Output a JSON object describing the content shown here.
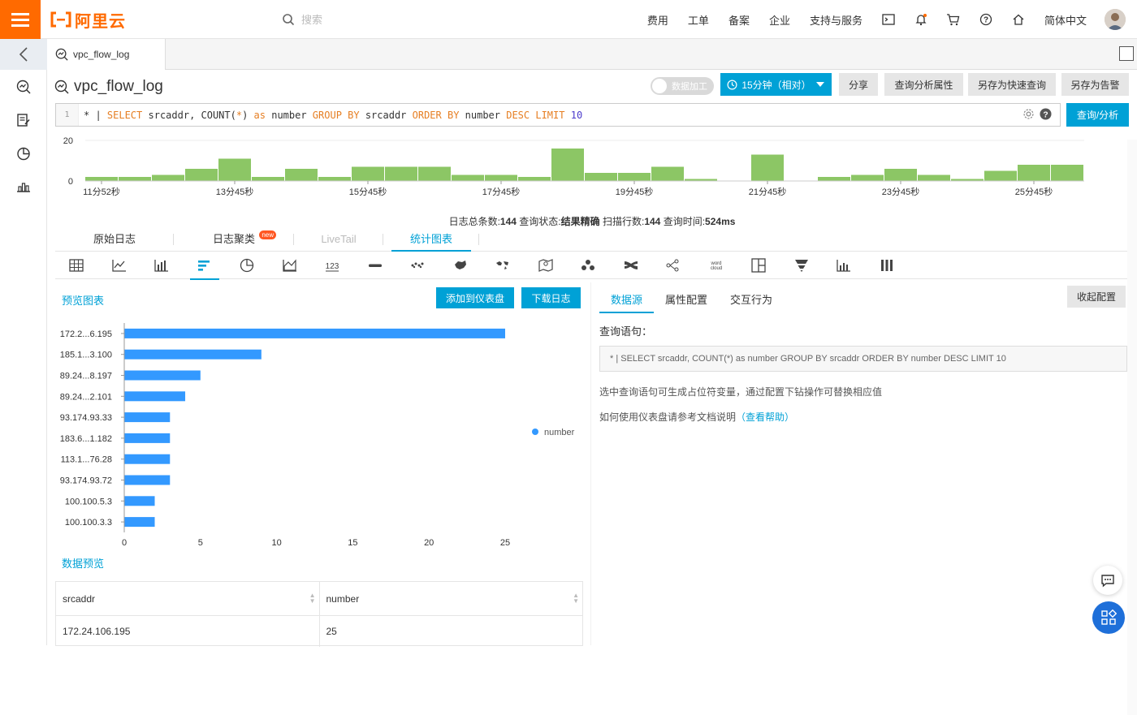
{
  "topbar": {
    "logo_text": "阿里云",
    "search_placeholder": "搜索",
    "nav": [
      "费用",
      "工单",
      "备案",
      "企业",
      "支持与服务"
    ],
    "language": "简体中文"
  },
  "tab": {
    "label": "vpc_flow_log"
  },
  "header": {
    "title": "vpc_flow_log",
    "toggle_label": "数据加工",
    "time_range": "15分钟（相对）",
    "buttons": [
      "分享",
      "查询分析属性",
      "另存为快速查询",
      "另存为告警"
    ]
  },
  "query": {
    "line": "1",
    "parts": [
      {
        "t": "* | ",
        "c": "p"
      },
      {
        "t": "SELECT",
        "c": "k"
      },
      {
        "t": " srcaddr, COUNT(",
        "c": "p"
      },
      {
        "t": "*",
        "c": "k"
      },
      {
        "t": ") ",
        "c": "p"
      },
      {
        "t": "as",
        "c": "k"
      },
      {
        "t": " number ",
        "c": "p"
      },
      {
        "t": "GROUP BY",
        "c": "k"
      },
      {
        "t": " srcaddr ",
        "c": "p"
      },
      {
        "t": "ORDER BY",
        "c": "k"
      },
      {
        "t": " number ",
        "c": "p"
      },
      {
        "t": "DESC",
        "c": "k"
      },
      {
        "t": " ",
        "c": "p"
      },
      {
        "t": "LIMIT",
        "c": "k"
      },
      {
        "t": " ",
        "c": "p"
      },
      {
        "t": "10",
        "c": "n"
      }
    ],
    "submit_label": "查询/分析"
  },
  "histogram": {
    "y_ticks": [
      "20",
      "0"
    ],
    "x_labels": [
      "11分52秒",
      "13分45秒",
      "15分45秒",
      "17分45秒",
      "19分45秒",
      "21分45秒",
      "23分45秒",
      "25分45秒"
    ],
    "values": [
      2,
      2,
      3,
      6,
      11,
      2,
      6,
      2,
      7,
      7,
      7,
      3,
      3,
      2,
      16,
      4,
      4,
      7,
      1,
      0,
      13,
      0,
      2,
      3,
      6,
      3,
      1,
      5,
      8,
      8
    ],
    "color": "#8cc665"
  },
  "summary": {
    "total_label": "日志总条数:",
    "total": "144",
    "status_label": "查询状态:",
    "status": "结果精确",
    "scan_label": "扫描行数:",
    "scan": "144",
    "time_label": "查询时间:",
    "time": "524ms"
  },
  "view_tabs": [
    {
      "label": "原始日志",
      "state": "normal"
    },
    {
      "label": "日志聚类",
      "state": "normal",
      "badge": "new"
    },
    {
      "label": "LiveTail",
      "state": "disabled"
    },
    {
      "label": "统计图表",
      "state": "active"
    }
  ],
  "chart_types": [
    "table",
    "line",
    "column",
    "bar",
    "pie",
    "area",
    "number",
    "progress",
    "map-dots",
    "china-map",
    "world-map",
    "amap",
    "flow",
    "sankey",
    "force",
    "word-cloud",
    "treemap",
    "funnel",
    "single-bar",
    "cross-table"
  ],
  "preview": {
    "title": "预览图表",
    "add_dashboard": "添加到仪表盘",
    "download_log": "下载日志"
  },
  "chart_data": {
    "type": "bar",
    "categories": [
      "172.2...6.195",
      "185.1...3.100",
      "89.24...8.197",
      "89.24...2.101",
      "93.174.93.33",
      "183.6...1.182",
      "113.1...76.28",
      "93.174.93.72",
      "100.100.5.3",
      "100.100.3.3"
    ],
    "series": [
      {
        "name": "number",
        "values": [
          25,
          9,
          5,
          4,
          3,
          3,
          3,
          3,
          2,
          2
        ]
      }
    ],
    "xlim": [
      0,
      25
    ],
    "x_ticks": [
      "0",
      "5",
      "10",
      "15",
      "20",
      "25"
    ],
    "legend": "right",
    "color": "#3399ff"
  },
  "data_preview": {
    "title": "数据预览",
    "columns": [
      "srcaddr",
      "number"
    ],
    "rows": [
      [
        "172.24.106.195",
        "25"
      ]
    ]
  },
  "right": {
    "tabs": [
      "数据源",
      "属性配置",
      "交互行为"
    ],
    "collapse": "收起配置",
    "query_label": "查询语句：",
    "query_text": "* | SELECT srcaddr, COUNT(*) as number GROUP BY srcaddr ORDER BY number DESC LIMIT 10",
    "hint1": "选中查询语句可生成占位符变量，通过配置下钻操作可替换相应值",
    "hint2": "如何使用仪表盘请参考文档说明",
    "help_link": "（查看帮助）"
  }
}
